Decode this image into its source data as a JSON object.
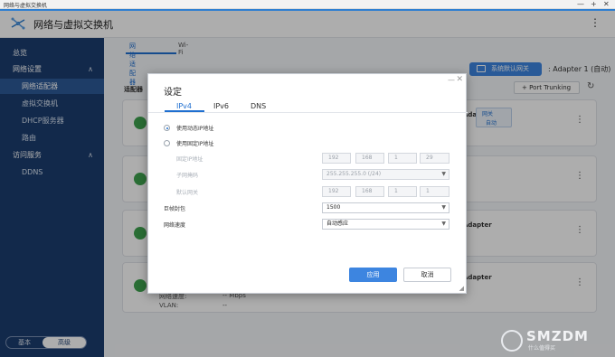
{
  "window": {
    "title": "网络与虚拟交换机",
    "controls": {
      "min": "—",
      "max": "+",
      "close": "✕"
    }
  },
  "app": {
    "title": "网络与虚拟交换机",
    "menu_icon": "kebab-icon"
  },
  "sidebar": {
    "overview": "总览",
    "network_settings": "网络设置",
    "items": [
      {
        "label": "网络适配器",
        "active": true
      },
      {
        "label": "虚拟交换机",
        "active": false
      },
      {
        "label": "DHCP服务器",
        "active": false
      },
      {
        "label": "路由",
        "active": false
      }
    ],
    "access_service": "访问服务",
    "access_items": [
      {
        "label": "DDNS"
      }
    ],
    "mode": {
      "basic": "基本",
      "advanced": "高级"
    }
  },
  "main": {
    "tabs": [
      {
        "label": "网络适配器"
      },
      {
        "label": "Wi-Fi"
      }
    ],
    "section_title": "适配器",
    "gateway_button": "系统默认网关",
    "adapter_text": ": Adapter 1 (自动)",
    "port_trunking": "Port Trunking",
    "cards": [
      {
        "name": "Adapter",
        "tag1": "网关",
        "tag2": "自动"
      },
      {
        "name": ""
      },
      {
        "name": "Adapter"
      },
      {
        "name": "Adapter"
      }
    ],
    "row_speed_label": "网络速度:",
    "row_speed_value": "-- Mbps",
    "row_vlan_label": "VLAN:",
    "row_vlan_value": "--"
  },
  "dialog": {
    "title": "设定",
    "tabs": [
      "IPv4",
      "IPv6",
      "DNS"
    ],
    "dhcp_label": "使用动态IP地址",
    "static_label": "使用固定IP地址",
    "fixed_ip_label": "固定IP地址",
    "ip": [
      "192",
      "168",
      "1",
      "29"
    ],
    "subnet_label": "子网掩码",
    "subnet_value": "255.255.255.0 (/24)",
    "gateway_label": "默认网关",
    "gateway": [
      "192",
      "168",
      "1",
      "1"
    ],
    "mtu_label": "巨帧封包",
    "mtu_value": "1500",
    "speed_label": "网络速度",
    "speed_value": "自动感应",
    "ok": "应用",
    "cancel": "取消"
  },
  "watermark": {
    "text": "SMZDM",
    "sub": "什么值得买"
  }
}
